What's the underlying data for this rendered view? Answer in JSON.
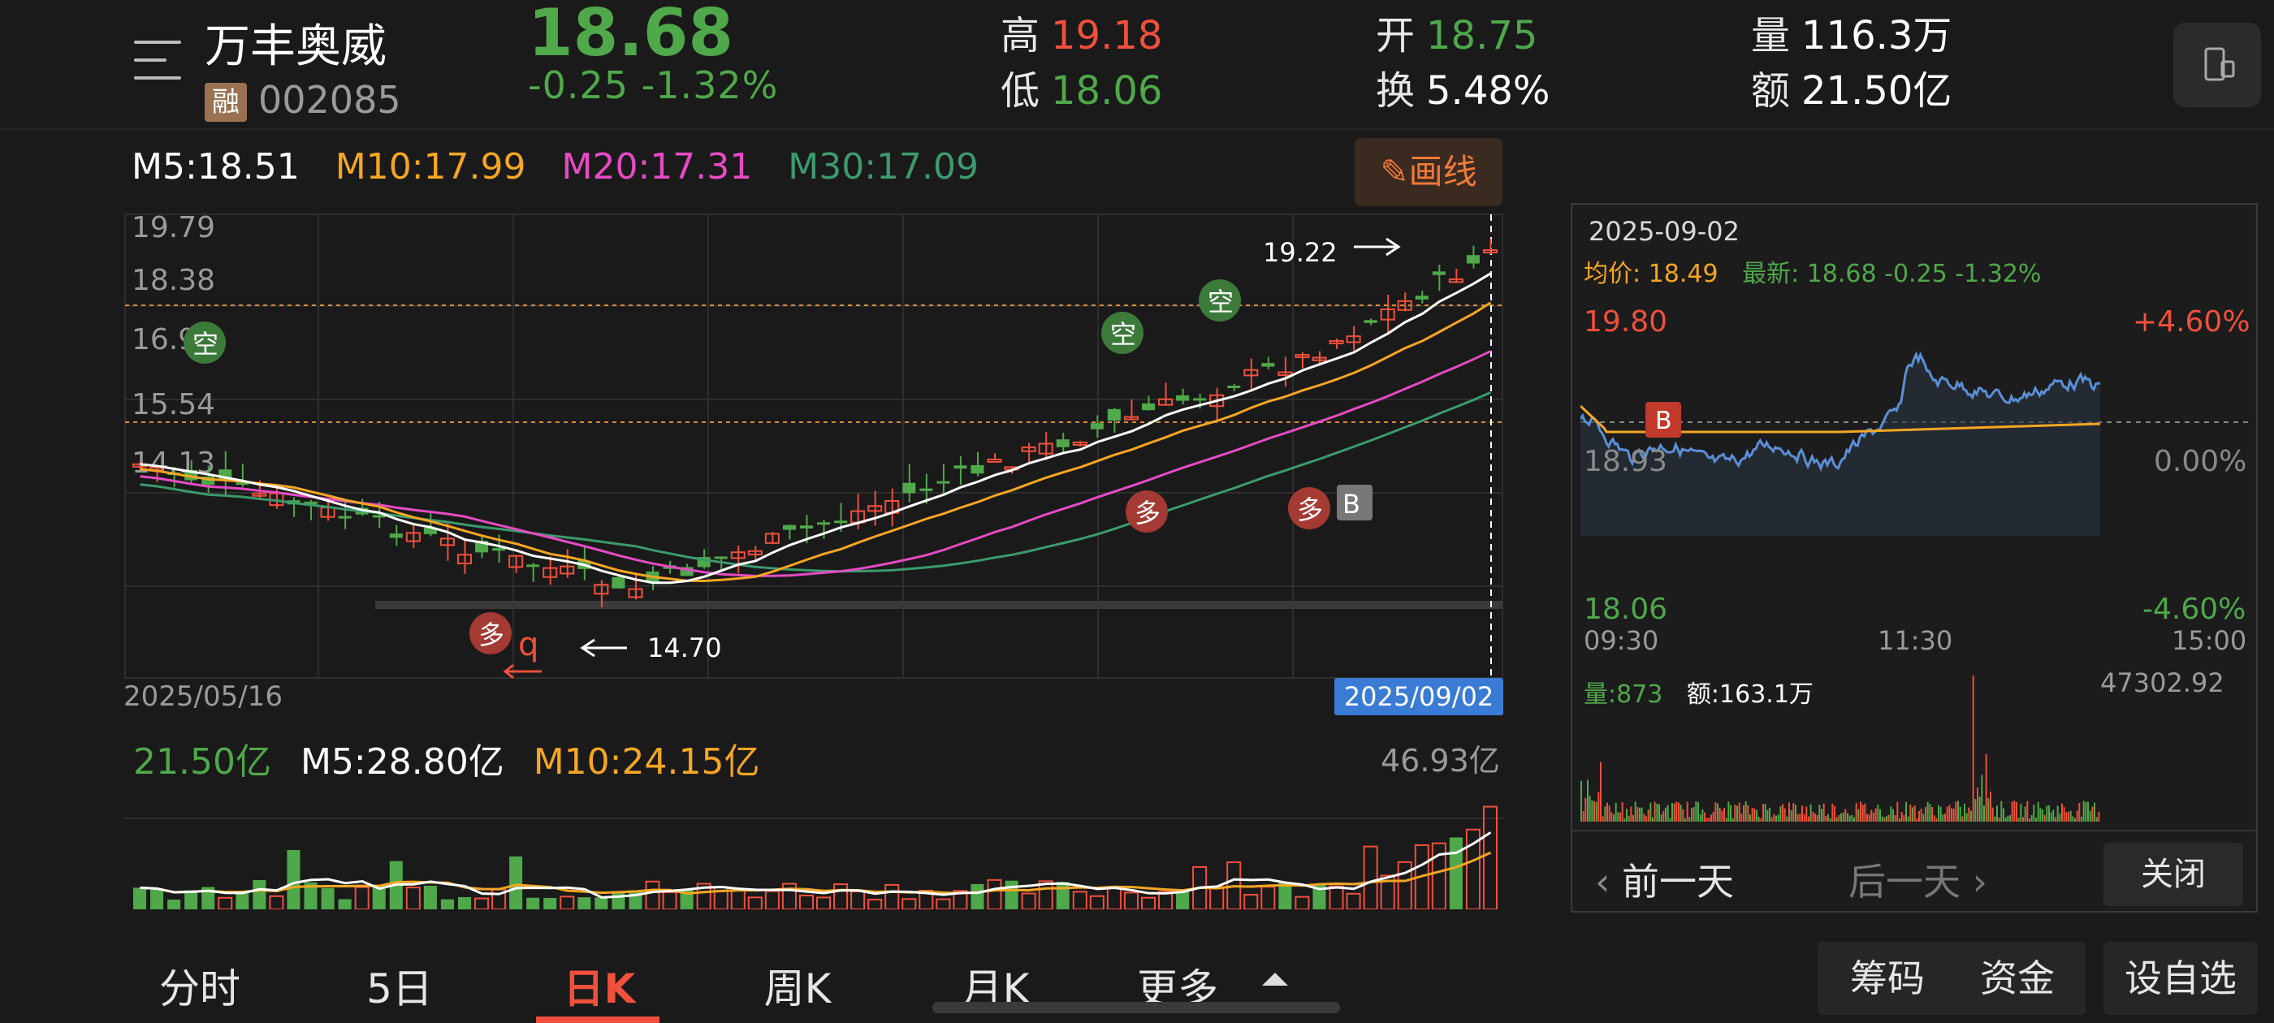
{
  "header": {
    "stock_name": "万丰奥威",
    "rong_badge": "融",
    "stock_code": "002085",
    "price": "18.68",
    "change": "-0.25   -1.32%",
    "high_label": "高",
    "high_value": "19.18",
    "low_label": "低",
    "low_value": "18.06",
    "open_label": "开",
    "open_value": "18.75",
    "turnover_label": "换",
    "turnover_value": "5.48%",
    "volume_label": "量",
    "volume_value": "116.3万",
    "amount_label": "额",
    "amount_value": "21.50亿"
  },
  "ma": {
    "m5": "M5:18.51",
    "m10": "M10:17.99",
    "m20": "M20:17.31",
    "m30": "M30:17.09"
  },
  "draw_button": "画线",
  "kchart": {
    "y_ticks": [
      "19.79",
      "18.38",
      "16.96",
      "15.54",
      "14.13"
    ],
    "high_annotation": "19.22",
    "low_annotation": "14.70",
    "date_start": "2025/05/16",
    "date_current": "2025/09/02",
    "signals": [
      "空",
      "空",
      "空",
      "多",
      "多",
      "多",
      "B",
      "B"
    ]
  },
  "volume": {
    "current": "21.50亿",
    "m5": "M5:28.80亿",
    "m10": "M10:24.15亿",
    "max": "46.93亿"
  },
  "tabs": [
    "分时",
    "5日",
    "日K",
    "周K",
    "月K",
    "更多"
  ],
  "active_tab": "日K",
  "right_buttons": [
    "筹码",
    "资金",
    "设自选"
  ],
  "panel": {
    "date": "2025-09-02",
    "avg_label": "均价: 18.49",
    "latest_label": "最新: 18.68 -0.25 -1.32%",
    "y_high": "19.80",
    "y_mid": "18.93",
    "y_low": "18.06",
    "pct_high": "+4.60%",
    "pct_mid": "0.00%",
    "pct_low": "-4.60%",
    "times": [
      "09:30",
      "11:30",
      "15:00"
    ],
    "buy_marker": "B",
    "vol_label": "量:873",
    "amount_label": "额:163.1万",
    "vol_max": "47302.92",
    "prev_day": "前一天",
    "next_day": "后一天",
    "close": "关闭"
  },
  "colors": {
    "up": "#f0503c",
    "down": "#4fa84a",
    "ma5": "#ffffff",
    "ma10": "#f5a623",
    "ma20": "#e64bc4",
    "ma30": "#3c9a6e",
    "intraday_line": "#5b8fd6",
    "avg_line": "#f5a623"
  }
}
